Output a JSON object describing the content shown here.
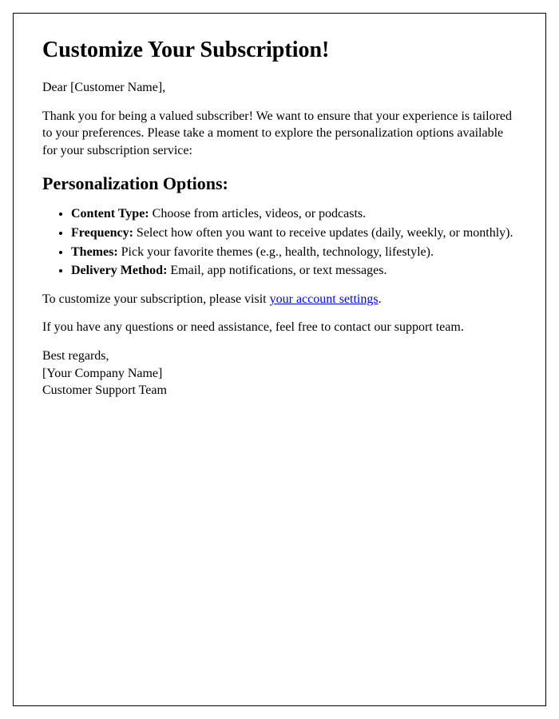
{
  "title": "Customize Your Subscription!",
  "greeting": "Dear [Customer Name],",
  "intro": "Thank you for being a valued subscriber! We want to ensure that your experience is tailored to your preferences. Please take a moment to explore the personalization options available for your subscription service:",
  "section_heading": "Personalization Options:",
  "options": [
    {
      "label": "Content Type:",
      "desc": " Choose from articles, videos, or podcasts."
    },
    {
      "label": "Frequency:",
      "desc": " Select how often you want to receive updates (daily, weekly, or monthly)."
    },
    {
      "label": "Themes:",
      "desc": " Pick your favorite themes (e.g., health, technology, lifestyle)."
    },
    {
      "label": "Delivery Method:",
      "desc": " Email, app notifications, or text messages."
    }
  ],
  "cta_prefix": "To customize your subscription, please visit ",
  "cta_link_text": "your account settings",
  "cta_suffix": ".",
  "support": "If you have any questions or need assistance, feel free to contact our support team.",
  "closing": "Best regards,",
  "company": "[Your Company Name]",
  "team": "Customer Support Team"
}
